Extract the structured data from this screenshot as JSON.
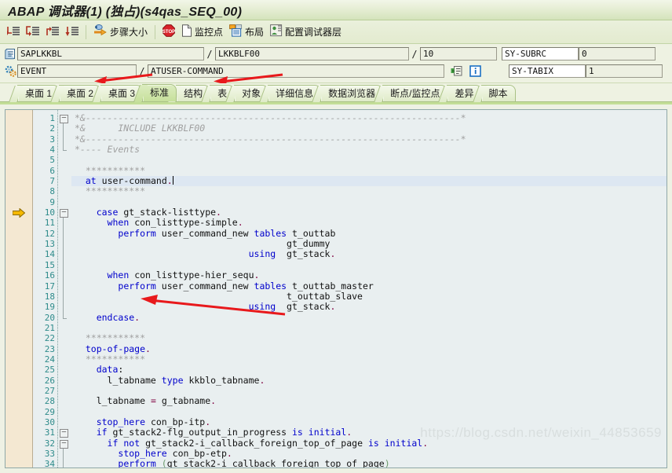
{
  "window": {
    "title": "ABAP 调试器(1) (独占)(s4qas_SEQ_00)"
  },
  "toolbar": {
    "items": [
      {
        "name": "step-into",
        "icon": "step-into-icon",
        "label": ""
      },
      {
        "name": "step-over",
        "icon": "step-over-icon",
        "label": ""
      },
      {
        "name": "step-out",
        "icon": "step-out-icon",
        "label": ""
      },
      {
        "name": "run-to-cursor",
        "icon": "run-to-cursor-icon",
        "label": ""
      },
      {
        "name": "step-size",
        "icon": "step-size-icon",
        "label": "步骤大小"
      },
      {
        "name": "stop",
        "icon": "stop-icon",
        "label": ""
      },
      {
        "name": "watchpoint",
        "icon": "document-icon",
        "label": "监控点"
      },
      {
        "name": "layout",
        "icon": "layout-icon",
        "label": "布局"
      },
      {
        "name": "configure-debugger-layer",
        "icon": "configure-icon",
        "label": "配置调试器层"
      }
    ]
  },
  "fields": {
    "row1": {
      "icon": "program-icon",
      "program": "SAPLKKBL",
      "sep1": "/",
      "include": "LKKBLF00",
      "sep2": "/",
      "line": "10",
      "sysfield_name": "SY-SUBRC",
      "sysfield_value": "0"
    },
    "row2": {
      "icon": "event-icon",
      "event_type": "EVENT",
      "sep1": "/",
      "event_name": "ATUSER-COMMAND",
      "icon2": "goto-icon",
      "icon3": "info-icon",
      "sysfield_name": "SY-TABIX",
      "sysfield_value": "1"
    }
  },
  "tabs": {
    "active_index": 3,
    "items": [
      {
        "label": "桌面 1"
      },
      {
        "label": "桌面 2"
      },
      {
        "label": "桌面 3"
      },
      {
        "label": "标准"
      },
      {
        "label": "结构"
      },
      {
        "label": "表"
      },
      {
        "label": "对象"
      },
      {
        "label": "详细信息"
      },
      {
        "label": "数据浏览器"
      },
      {
        "label": "断点/监控点"
      },
      {
        "label": "差异"
      },
      {
        "label": "脚本"
      }
    ]
  },
  "editor": {
    "current_line": 10,
    "cursor_line": 7,
    "watermark": "https://blog.csdn.net/weixin_44853659",
    "lines": [
      {
        "n": 1,
        "fold": "box-minus",
        "text": "*&---------------------------------------------------------------------*"
      },
      {
        "n": 2,
        "fold": "bar",
        "text": "*&      INCLUDE LKKBLF00"
      },
      {
        "n": 3,
        "fold": "bar",
        "text": "*&---------------------------------------------------------------------*"
      },
      {
        "n": 4,
        "fold": "end",
        "text": "*---- Events"
      },
      {
        "n": 5,
        "fold": "",
        "text": ""
      },
      {
        "n": 6,
        "fold": "",
        "text": "  ***********"
      },
      {
        "n": 7,
        "fold": "",
        "text": "  at user-command."
      },
      {
        "n": 8,
        "fold": "",
        "text": "  ***********"
      },
      {
        "n": 9,
        "fold": "",
        "text": ""
      },
      {
        "n": 10,
        "fold": "box-minus",
        "text": "    case gt_stack-listtype."
      },
      {
        "n": 11,
        "fold": "bar",
        "text": "      when con_listtype-simple."
      },
      {
        "n": 12,
        "fold": "bar",
        "text": "        perform user_command_new tables t_outtab"
      },
      {
        "n": 13,
        "fold": "bar",
        "text": "                                       gt_dummy"
      },
      {
        "n": 14,
        "fold": "bar",
        "text": "                                using  gt_stack."
      },
      {
        "n": 15,
        "fold": "bar",
        "text": ""
      },
      {
        "n": 16,
        "fold": "bar",
        "text": "      when con_listtype-hier_sequ."
      },
      {
        "n": 17,
        "fold": "bar",
        "text": "        perform user_command_new tables t_outtab_master"
      },
      {
        "n": 18,
        "fold": "bar",
        "text": "                                       t_outtab_slave"
      },
      {
        "n": 19,
        "fold": "bar",
        "text": "                                using  gt_stack."
      },
      {
        "n": 20,
        "fold": "end",
        "text": "    endcase."
      },
      {
        "n": 21,
        "fold": "",
        "text": ""
      },
      {
        "n": 22,
        "fold": "",
        "text": "  ***********"
      },
      {
        "n": 23,
        "fold": "",
        "text": "  top-of-page."
      },
      {
        "n": 24,
        "fold": "",
        "text": "  ***********"
      },
      {
        "n": 25,
        "fold": "",
        "text": "    data:"
      },
      {
        "n": 26,
        "fold": "",
        "text": "      l_tabname type kkblo_tabname."
      },
      {
        "n": 27,
        "fold": "",
        "text": ""
      },
      {
        "n": 28,
        "fold": "",
        "text": "    l_tabname = g_tabname."
      },
      {
        "n": 29,
        "fold": "",
        "text": ""
      },
      {
        "n": 30,
        "fold": "",
        "text": "    stop_here con_bp-itp."
      },
      {
        "n": 31,
        "fold": "box-minus",
        "text": "    if gt_stack2-flg_output_in_progress is initial."
      },
      {
        "n": 32,
        "fold": "box-minus2",
        "text": "      if not gt_stack2-i_callback_foreign_top_of_page is initial."
      },
      {
        "n": 33,
        "fold": "bar",
        "text": "        stop_here con_bp-etp."
      },
      {
        "n": 34,
        "fold": "bar",
        "text": "        perform (gt_stack2-i_callback_foreign_top_of_page)"
      }
    ]
  }
}
